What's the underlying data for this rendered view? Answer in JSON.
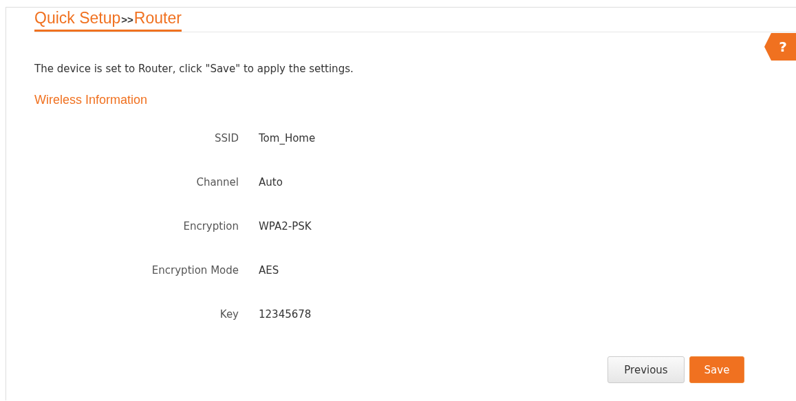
{
  "breadcrumb": {
    "items": [
      "Quick Setup",
      "Router"
    ],
    "separator": ">>"
  },
  "help_button": {
    "label": "?"
  },
  "intro": "The device is set to Router, click \"Save\" to apply the settings.",
  "section_title": "Wireless Information",
  "fields": [
    {
      "label": "SSID",
      "value": "Tom_Home"
    },
    {
      "label": "Channel",
      "value": "Auto"
    },
    {
      "label": "Encryption",
      "value": "WPA2-PSK"
    },
    {
      "label": "Encryption Mode",
      "value": "AES"
    },
    {
      "label": "Key",
      "value": "12345678"
    }
  ],
  "buttons": [
    {
      "label": "Previous",
      "kind": "secondary"
    },
    {
      "label": "Save",
      "kind": "primary"
    }
  ]
}
